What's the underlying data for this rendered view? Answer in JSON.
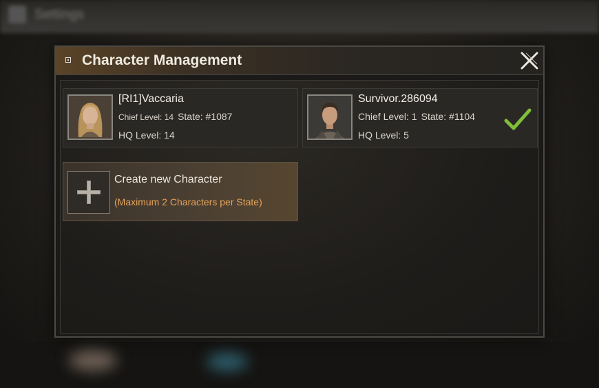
{
  "background": {
    "topbar_title": "Settings"
  },
  "dialog": {
    "title": "Character Management",
    "close_icon": "close-icon"
  },
  "characters": [
    {
      "name": "[RI1]Vaccaria",
      "chief_level_label": "Chief Level: 14",
      "state_label": "State: #1087",
      "hq_level_label": "HQ Level: 14",
      "selected": false,
      "avatar": "female-portrait"
    },
    {
      "name": "Survivor.286094",
      "chief_level_label": "Chief Level: 1",
      "state_label": "State: #1104",
      "hq_level_label": "HQ Level: 5",
      "selected": true,
      "avatar": "male-portrait"
    }
  ],
  "create": {
    "title": "Create new Character",
    "subtitle": "(Maximum 2 Characters per State)",
    "icon": "plus-icon"
  },
  "colors": {
    "accent_orange": "#e8a35a",
    "check_green": "#7fbf3a"
  }
}
